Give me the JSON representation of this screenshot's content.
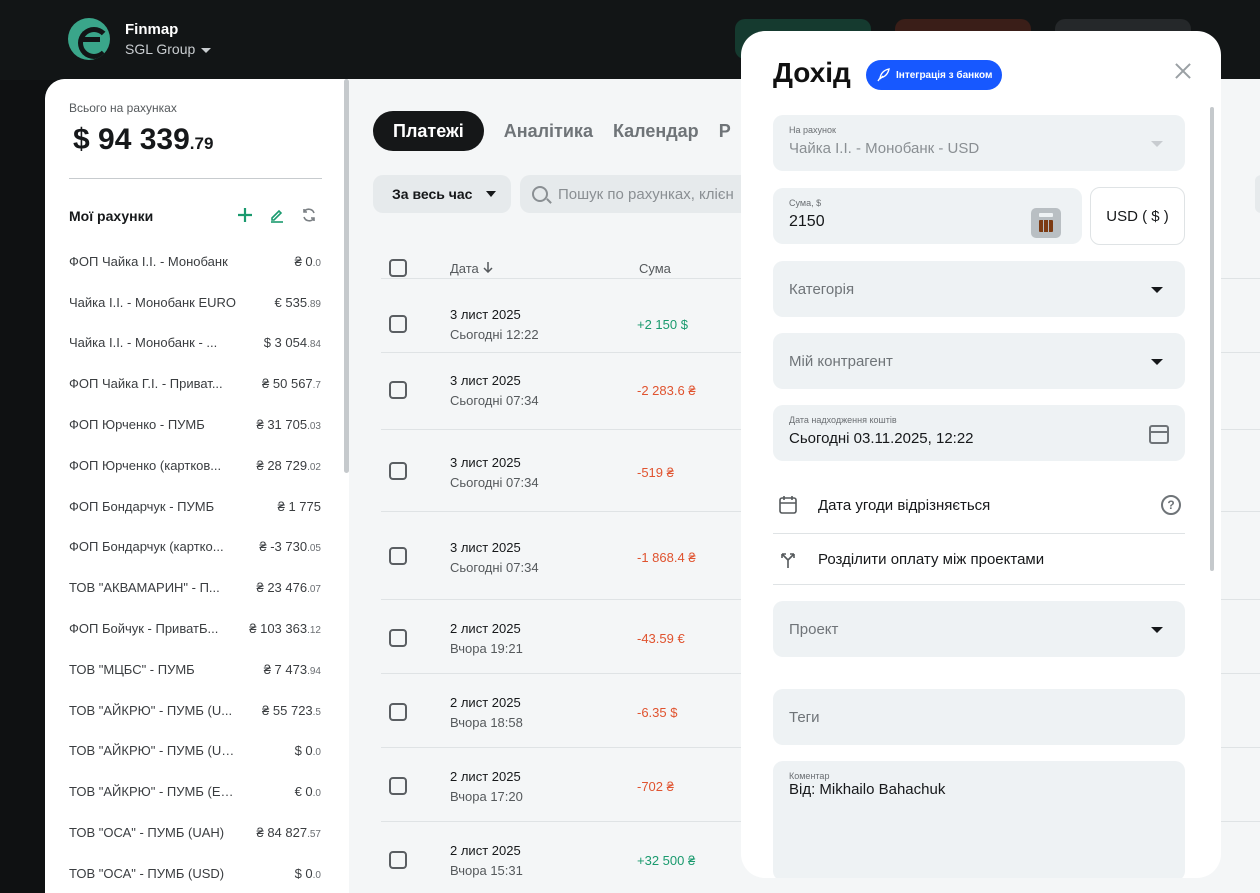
{
  "header": {
    "brand": "Finmap",
    "org": "SGL Group"
  },
  "sidebar": {
    "total_label": "Всього на рахунках",
    "total_main": "$ 94 339",
    "total_cents": ".79",
    "accounts_title": "Мої рахунки",
    "accounts": [
      {
        "name": "ФОП Чайка І.І. - Монобанк",
        "bal": "₴ 0",
        "cents": ".0"
      },
      {
        "name": "Чайка І.І. - Монобанк EURO",
        "bal": "€ 535",
        "cents": ".89"
      },
      {
        "name": "Чайка І.І. - Монобанк - ...",
        "bal": "$ 3 054",
        "cents": ".84"
      },
      {
        "name": "ФОП Чайка Г.І. - Приват...",
        "bal": "₴ 50 567",
        "cents": ".7"
      },
      {
        "name": "ФОП Юрченко - ПУМБ",
        "bal": "₴ 31 705",
        "cents": ".03"
      },
      {
        "name": "ФОП Юрченко (картков...",
        "bal": "₴ 28 729",
        "cents": ".02"
      },
      {
        "name": "ФОП Бондарчук - ПУМБ",
        "bal": "₴ 1 775",
        "cents": ""
      },
      {
        "name": "ФОП Бондарчук (картко...",
        "bal": "₴ -3 730",
        "cents": ".05"
      },
      {
        "name": "ТОВ \"АКВАМАРИН\" - П...",
        "bal": "₴ 23 476",
        "cents": ".07"
      },
      {
        "name": "ФОП Бойчук - ПриватБ...",
        "bal": "₴ 103 363",
        "cents": ".12"
      },
      {
        "name": "ТОВ \"МЦБС\" - ПУМБ",
        "bal": "₴ 7 473",
        "cents": ".94"
      },
      {
        "name": "ТОВ \"АЙКРЮ\" - ПУМБ (U...",
        "bal": "₴ 55 723",
        "cents": ".5"
      },
      {
        "name": "ТОВ \"АЙКРЮ\" - ПУМБ (USD)",
        "bal": "$ 0",
        "cents": ".0"
      },
      {
        "name": "ТОВ \"АЙКРЮ\" - ПУМБ (EUR)",
        "bal": "€ 0",
        "cents": ".0"
      },
      {
        "name": "ТОВ \"ОСА\" - ПУМБ (UAH)",
        "bal": "₴ 84 827",
        "cents": ".57"
      },
      {
        "name": "ТОВ \"ОСА\" - ПУМБ (USD)",
        "bal": "$ 0",
        "cents": ".0"
      }
    ]
  },
  "main": {
    "tabs": [
      "Платежі",
      "Аналітика",
      "Календар",
      "Р"
    ],
    "period": "За весь час",
    "search_placeholder": "Пошук по рахунках, клієн",
    "col_date": "Дата",
    "col_sum": "Сума",
    "rows": [
      {
        "date": "3 лист 2025",
        "time": "Сьогодні 12:22",
        "amount": "+2 150  $",
        "type": "pos"
      },
      {
        "date": "3 лист 2025",
        "time": "Сьогодні 07:34",
        "amount": "-2 283.6 ₴",
        "type": "neg"
      },
      {
        "date": "3 лист 2025",
        "time": "Сьогодні 07:34",
        "amount": "-519 ₴",
        "type": "neg"
      },
      {
        "date": "3 лист 2025",
        "time": "Сьогодні 07:34",
        "amount": "-1 868.4 ₴",
        "type": "neg"
      },
      {
        "date": "2 лист 2025",
        "time": "Вчора 19:21",
        "amount": "-43.59 €",
        "type": "neg"
      },
      {
        "date": "2 лист 2025",
        "time": "Вчора 18:58",
        "amount": "-6.35  $",
        "type": "neg"
      },
      {
        "date": "2 лист 2025",
        "time": "Вчора 17:20",
        "amount": "-702 ₴",
        "type": "neg"
      },
      {
        "date": "2 лист 2025",
        "time": "Вчора 15:31",
        "amount": "+32 500 ₴",
        "type": "pos"
      }
    ]
  },
  "modal": {
    "title": "Дохід",
    "bank_button": "Інтеграція з банком",
    "account_label": "На рахунок",
    "account_value": "Чайка І.І. - Монобанк - USD",
    "sum_label": "Сума, $",
    "sum_value": "2150",
    "currency": "USD ( $ )",
    "category_placeholder": "Категорія",
    "counterparty_placeholder": "Мій контрагент",
    "date_label": "Дата надходження коштів",
    "date_value": "Сьогодні 03.11.2025, 12:22",
    "deal_date_option": "Дата угоди відрізняється",
    "split_option": "Розділити оплату між проектами",
    "project_placeholder": "Проект",
    "tags_placeholder": "Теги",
    "comment_label": "Коментар",
    "comment_value": "Від: Mikhailo Bahachuk"
  },
  "colors": {
    "accent_green": "#1a9a6e",
    "negative": "#e0532f",
    "bank_blue": "#1758ff"
  }
}
